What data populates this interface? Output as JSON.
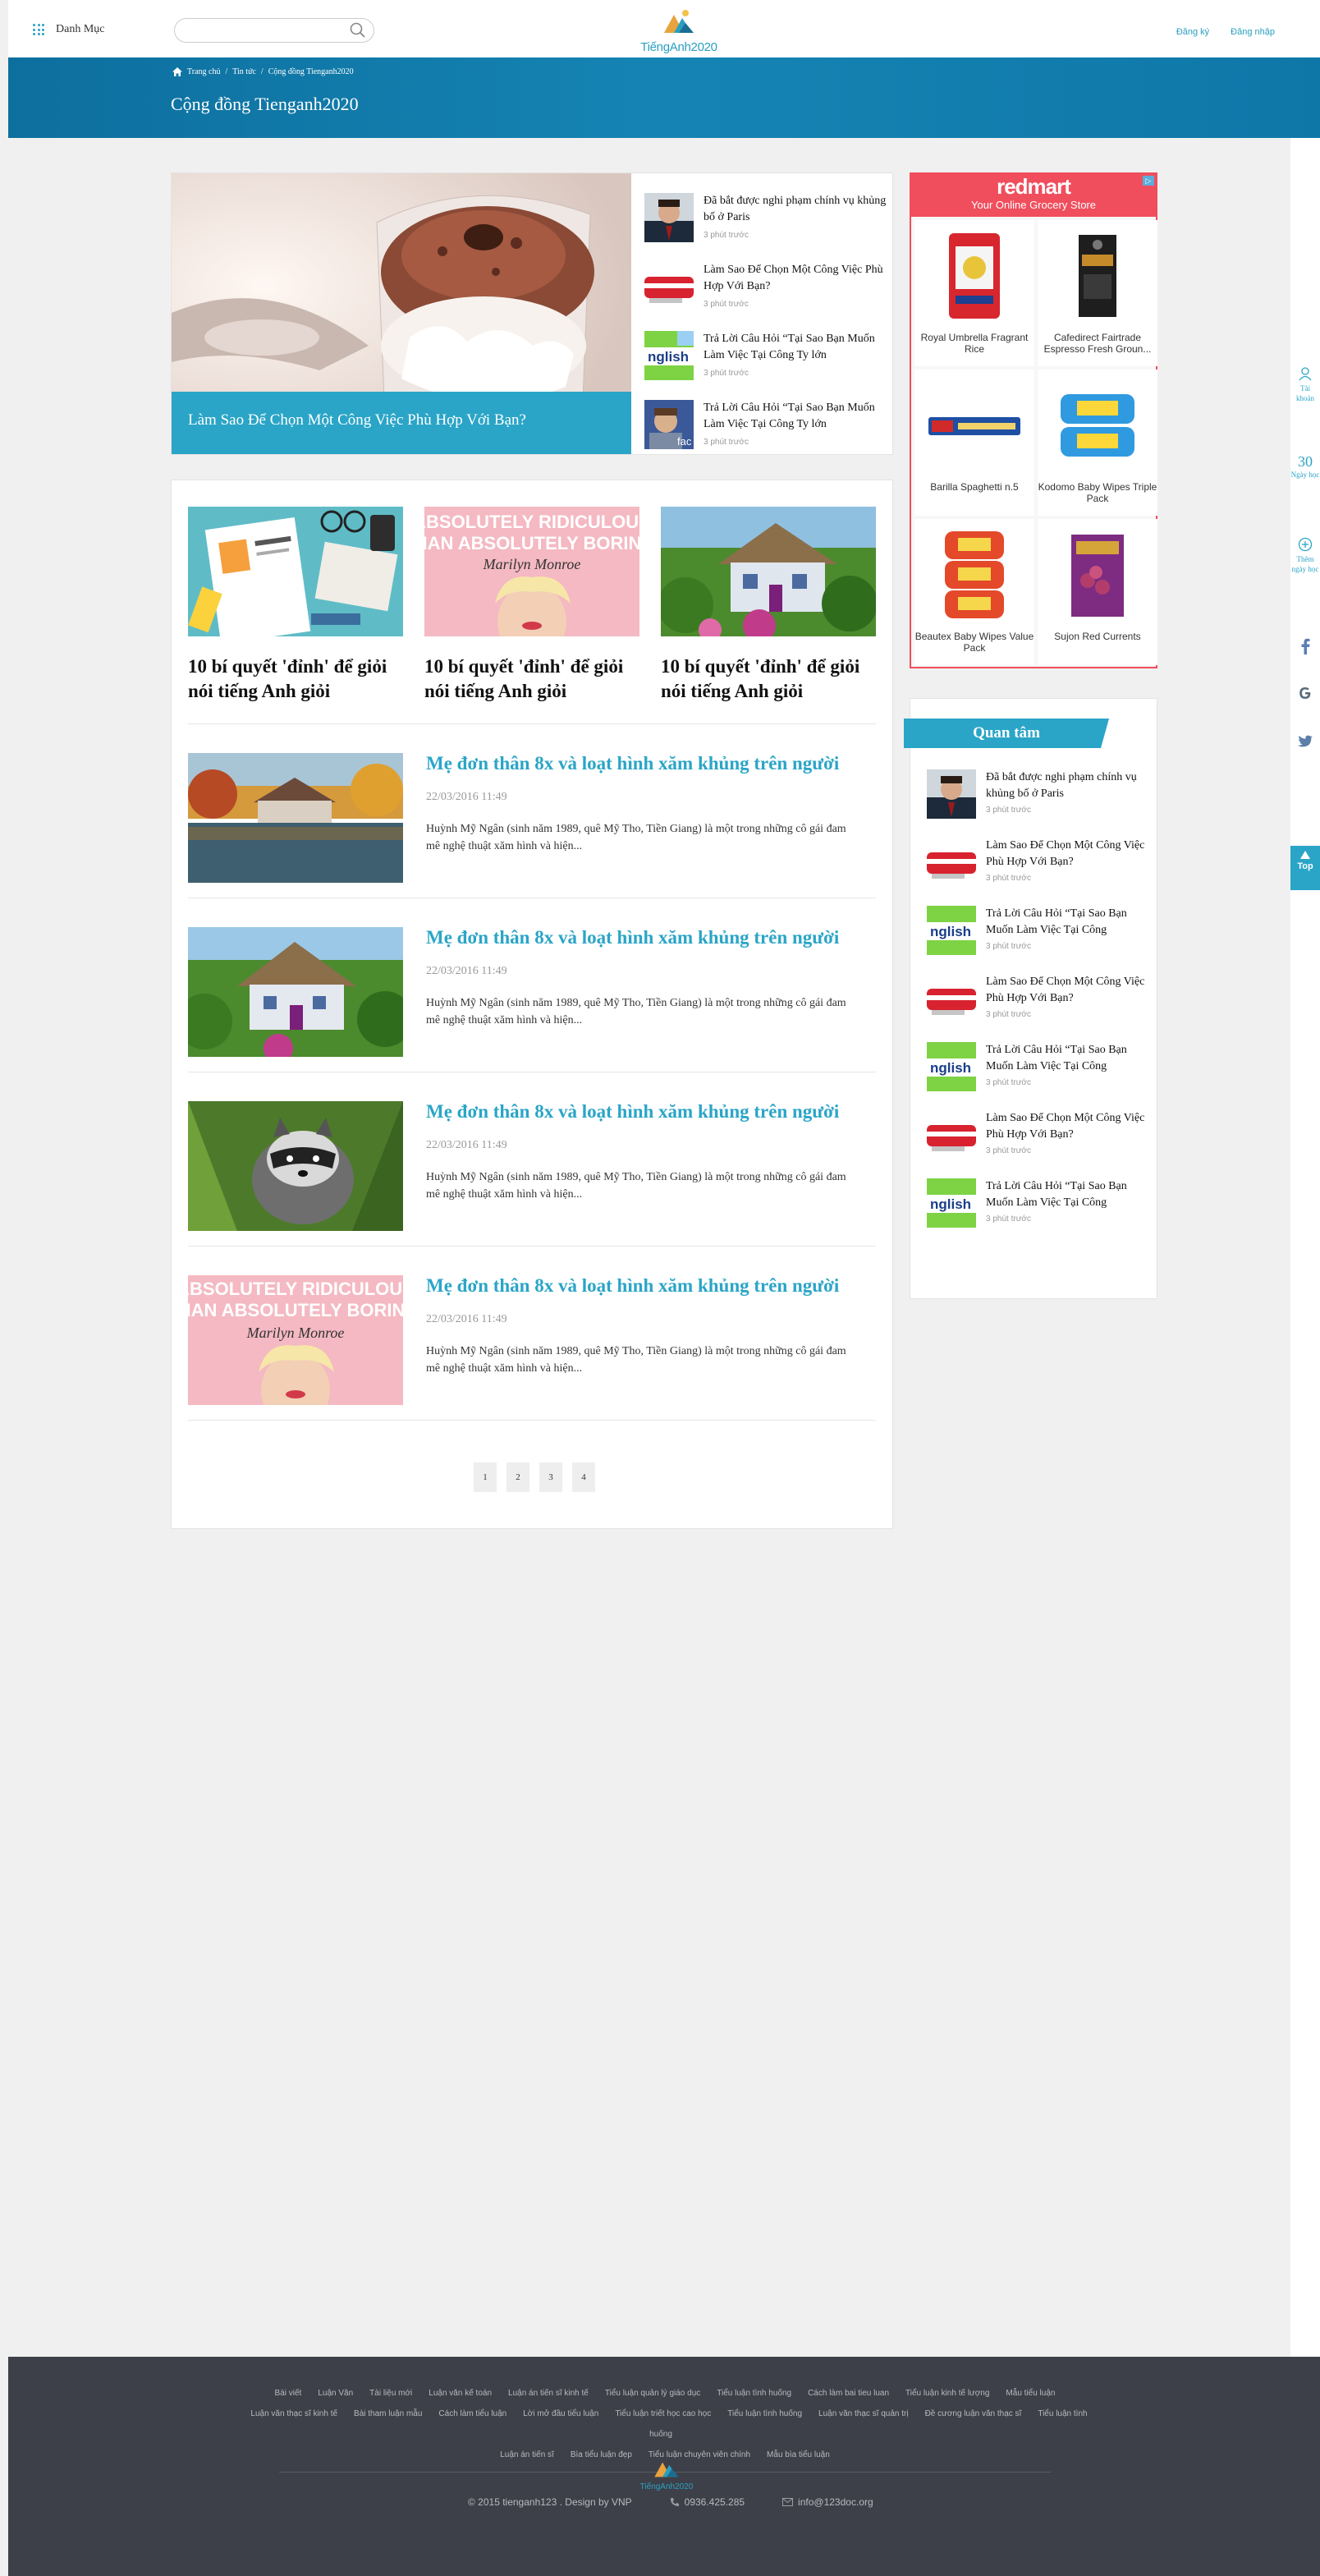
{
  "header": {
    "menu_label": "Danh Mục",
    "search_placeholder": "",
    "logo_text": "TiếngAnh2020",
    "register": "Đăng ký",
    "login": "Đăng nhập"
  },
  "banner": {
    "breadcrumb": [
      "Trang chủ",
      "Tin tức",
      "Cộng đồng Tienganh2020"
    ],
    "title": "Cộng đồng Tienganh2020"
  },
  "featured": {
    "caption": "Làm Sao Để Chọn Một Công Việc Phù Hợp Với Bạn?",
    "side": [
      {
        "title": "Đã bắt được nghi phạm chính vụ khủng bố ở Paris",
        "time": "3 phút trước"
      },
      {
        "title": "Làm Sao Để Chọn Một Công Việc Phù Hợp Với Bạn?",
        "time": "3 phút trước"
      },
      {
        "title": "Trả Lời Câu Hỏi “Tại Sao Bạn Muốn Làm Việc Tại Công Ty lớn",
        "time": "3 phút trước"
      },
      {
        "title": "Trả Lời Câu Hỏi “Tại Sao Bạn Muốn Làm Việc Tại Công Ty lớn",
        "time": "3 phút trước"
      }
    ]
  },
  "cards": [
    {
      "title": "10 bí quyết 'đỉnh' để giỏi nói tiếng Anh giỏi"
    },
    {
      "title": "10 bí quyết 'đỉnh' để giỏi nói tiếng Anh giỏi",
      "img_text1": "ABSOLUTELY RIDICULOUS",
      "img_text2": "THAN ABSOLUTELY BORING.",
      "img_text3": "Marilyn Monroe"
    },
    {
      "title": "10 bí quyết 'đỉnh' để giỏi nói tiếng Anh giỏi"
    }
  ],
  "articles": [
    {
      "title": "Mẹ đơn thân 8x và loạt hình xăm khủng trên người",
      "date": "22/03/2016 11:49",
      "excerpt": "Huỳnh Mỹ Ngân (sinh năm 1989, quê Mỹ Tho, Tiền Giang) là một trong những cô gái đam mê nghệ thuật xăm hình và hiện..."
    },
    {
      "title": "Mẹ đơn thân 8x và loạt hình xăm khủng trên người",
      "date": "22/03/2016 11:49",
      "excerpt": "Huỳnh Mỹ Ngân (sinh năm 1989, quê Mỹ Tho, Tiền Giang) là một trong những cô gái đam mê nghệ thuật xăm hình và hiện..."
    },
    {
      "title": "Mẹ đơn thân 8x và loạt hình xăm khủng trên người",
      "date": "22/03/2016 11:49",
      "excerpt": "Huỳnh Mỹ Ngân (sinh năm 1989, quê Mỹ Tho, Tiền Giang) là một trong những cô gái đam mê nghệ thuật xăm hình và hiện..."
    },
    {
      "title": "Mẹ đơn thân 8x và loạt hình xăm khủng trên người",
      "date": "22/03/2016 11:49",
      "excerpt": "Huỳnh Mỹ Ngân (sinh năm 1989, quê Mỹ Tho, Tiền Giang) là một trong những cô gái đam mê nghệ thuật xăm hình và hiện...",
      "img_text1": "ABSOLUTELY RIDICULOUS",
      "img_text2": "THAN ABSOLUTELY BORING.",
      "img_text3": "Marilyn Monroe"
    }
  ],
  "pager": [
    "1",
    "2",
    "3",
    "4"
  ],
  "ad": {
    "brand": "redmart",
    "tagline": "Your Online Grocery Store",
    "items": [
      "Royal Umbrella Fragrant Rice",
      "Cafedirect Fairtrade Espresso Fresh Groun...",
      "Barilla Spaghetti n.5",
      "Kodomo Baby Wipes Triple Pack",
      "Beautex Baby Wipes Value Pack",
      "Sujon Red Currents"
    ]
  },
  "quantam": {
    "heading": "Quan tâm",
    "items": [
      {
        "title": "Đã bắt được nghi phạm chính vụ khủng bố ở Paris",
        "time": "3 phút trước"
      },
      {
        "title": "Làm Sao Để Chọn Một Công Việc Phù Hợp Với Bạn?",
        "time": "3 phút trước"
      },
      {
        "title": "Trả Lời Câu Hỏi “Tại Sao Bạn Muốn Làm Việc Tại Công",
        "time": "3 phút trước"
      },
      {
        "title": "Làm Sao Để Chọn Một Công Việc Phù Hợp Với Bạn?",
        "time": "3 phút trước"
      },
      {
        "title": "Trả Lời Câu Hỏi “Tại Sao Bạn Muốn Làm Việc Tại Công",
        "time": "3 phút trước"
      },
      {
        "title": "Làm Sao Để Chọn Một Công Việc Phù Hợp Với Bạn?",
        "time": "3 phút trước"
      },
      {
        "title": "Trả Lời Câu Hỏi “Tại Sao Bạn Muốn Làm Việc Tại Công",
        "time": "3 phút trước"
      }
    ]
  },
  "rail": {
    "account": "Tài khoản",
    "days_num": "30",
    "days_label": "Ngày học",
    "add_days": "Thêm ngày học",
    "top": "Top"
  },
  "footer": {
    "links": [
      "Bài viết",
      "Luận Văn",
      "Tài liệu mới",
      "Luận văn kế toán",
      "Luận án tiến sĩ kinh tế",
      "Tiểu luận quản lý giáo dục",
      "Tiểu luận tình huống",
      "Cách làm bai tieu luan",
      "Tiểu luận kinh tế lượng",
      "Mẫu tiểu luận",
      "Luận văn thạc sĩ kinh tế",
      "Bài tham luận mẫu",
      "Cách làm tiểu luận",
      "Lời mở đầu tiểu luận",
      "Tiểu luận triết học cao học",
      "Tiểu luận tình huống",
      "Luận văn thạc sĩ quản trị",
      "Đề cương luận văn thạc sĩ",
      "Tiểu luận tình huống",
      "Luận án tiến sĩ",
      "Bìa tiểu luận đẹp",
      "Tiểu luận chuyên viên chính",
      "Mẫu bìa tiểu luận"
    ],
    "logo_text": "TiếngAnh2020",
    "copyright": "© 2015 tienganh123 . Design by VNP",
    "phone": "0936.425.285",
    "email": "info@123doc.org"
  },
  "colors": {
    "accent": "#2aa5c7",
    "banner": "#1584b4",
    "ad": "#f04e5d",
    "footer": "#3e4049"
  }
}
